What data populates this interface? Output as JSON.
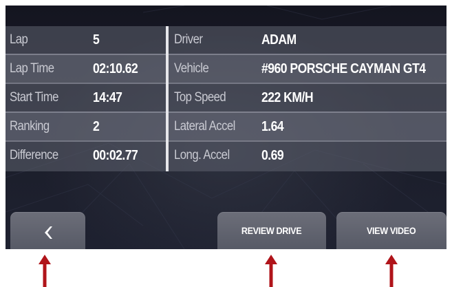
{
  "colors": {
    "arrow_red": "#b0141a",
    "panel_text_label": "#c9cad2",
    "panel_text_value": "#ffffff",
    "button_bg": "#60636f"
  },
  "stats": {
    "left": [
      {
        "label": "Lap",
        "value": "5"
      },
      {
        "label": "Lap Time",
        "value": "02:10.62"
      },
      {
        "label": "Start Time",
        "value": "14:47"
      },
      {
        "label": "Ranking",
        "value": "2"
      },
      {
        "label": "Difference",
        "value": "00:02.77"
      }
    ],
    "right": [
      {
        "label": "Driver",
        "value": "ADAM"
      },
      {
        "label": "Vehicle",
        "value": "#960 PORSCHE CAYMAN GT4"
      },
      {
        "label": "Top Speed",
        "value": "222 KM/H"
      },
      {
        "label": "Lateral Accel",
        "value": "1.64"
      },
      {
        "label": "Long. Accel",
        "value": "0.69"
      }
    ]
  },
  "buttons": {
    "back_icon": "chevron-left-icon",
    "review_label": "REVIEW DRIVE",
    "video_label": "VIEW VIDEO"
  },
  "annotations": {
    "arrow_icon": "red-up-arrow-icon",
    "count": 3
  }
}
